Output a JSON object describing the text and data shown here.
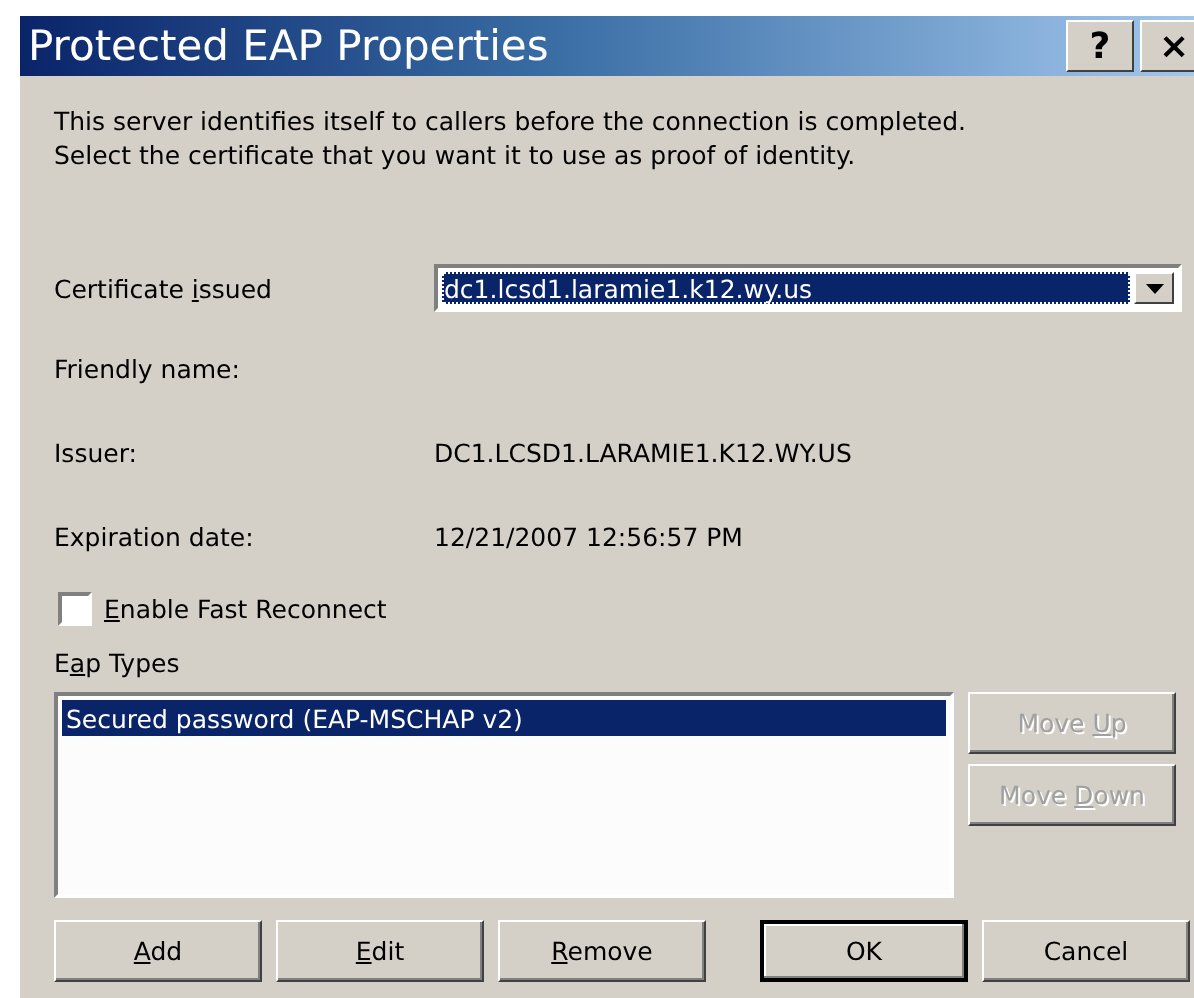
{
  "window": {
    "title": "Protected EAP Properties",
    "title_buttons": [
      "?",
      "×"
    ]
  },
  "description": [
    "This server identifies itself to callers before the connection is completed.",
    "Select the certificate that you want it to use as proof of identity."
  ],
  "certificate": {
    "label": {
      "before": "Certificate ",
      "access_key": "i",
      "after": "ssued"
    },
    "value": "dc1.lcsd1.laramie1.k12.wy.us"
  },
  "fields": [
    {
      "label": "Friendly name:"
    },
    {
      "label": "Issuer:",
      "value": "DC1.LCSD1.LARAMIE1.K12.WY.US"
    },
    {
      "label": "Expiration date:",
      "value": "12/21/2007 12:56:57 PM"
    }
  ],
  "fast_reconnect": {
    "label": {
      "access_key": "E",
      "after": "nable Fast Reconnect"
    },
    "checked": false
  },
  "eap_types": {
    "label": {
      "before": "E",
      "access_key": "a",
      "after": "p Types"
    },
    "items": [
      {
        "label": "Secured password (EAP-MSCHAP v2)",
        "selected": true
      }
    ]
  },
  "side_buttons": [
    {
      "label": {
        "before": "Move ",
        "access_key": "U",
        "after": "p"
      },
      "disabled": true
    },
    {
      "label": {
        "before": "Move ",
        "access_key": "D",
        "after": "own"
      },
      "disabled": true
    }
  ],
  "buttons": [
    {
      "label": {
        "access_key": "A",
        "after": "dd"
      },
      "default": false
    },
    {
      "label": {
        "access_key": "E",
        "after": "dit"
      },
      "default": false
    },
    {
      "label": {
        "access_key": "R",
        "after": "emove"
      },
      "default": false
    },
    {
      "label": {
        "before": "OK"
      },
      "default": true
    },
    {
      "label": {
        "before": "Cancel"
      },
      "default": false
    }
  ]
}
